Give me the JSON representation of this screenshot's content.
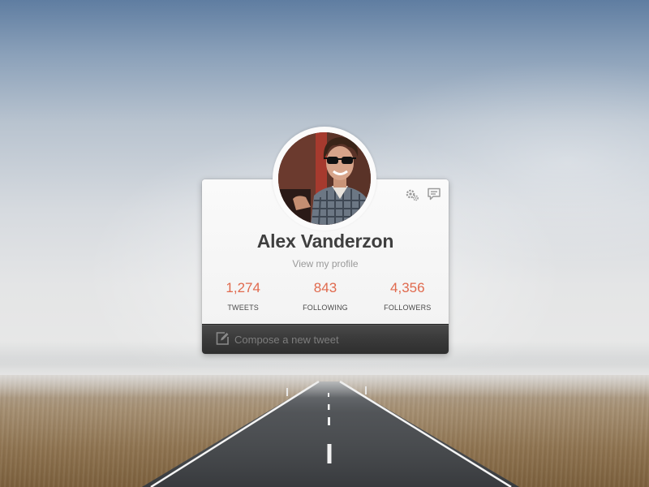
{
  "profile": {
    "name": "Alex Vanderzon",
    "view_link": "View my profile"
  },
  "stats": [
    {
      "value": "1,274",
      "label": "TWEETS"
    },
    {
      "value": "843",
      "label": "FOLLOWING"
    },
    {
      "value": "4,356",
      "label": "FOLLOWERS"
    }
  ],
  "actions": {
    "settings_icon": "gears-icon",
    "messages_icon": "speech-bubble-icon"
  },
  "compose": {
    "placeholder": "Compose a new tweet",
    "icon": "pencil-edit-icon"
  },
  "colors": {
    "accent": "#e06a4e",
    "name_text": "#3f3f3f",
    "compose_bar": "#353535"
  }
}
